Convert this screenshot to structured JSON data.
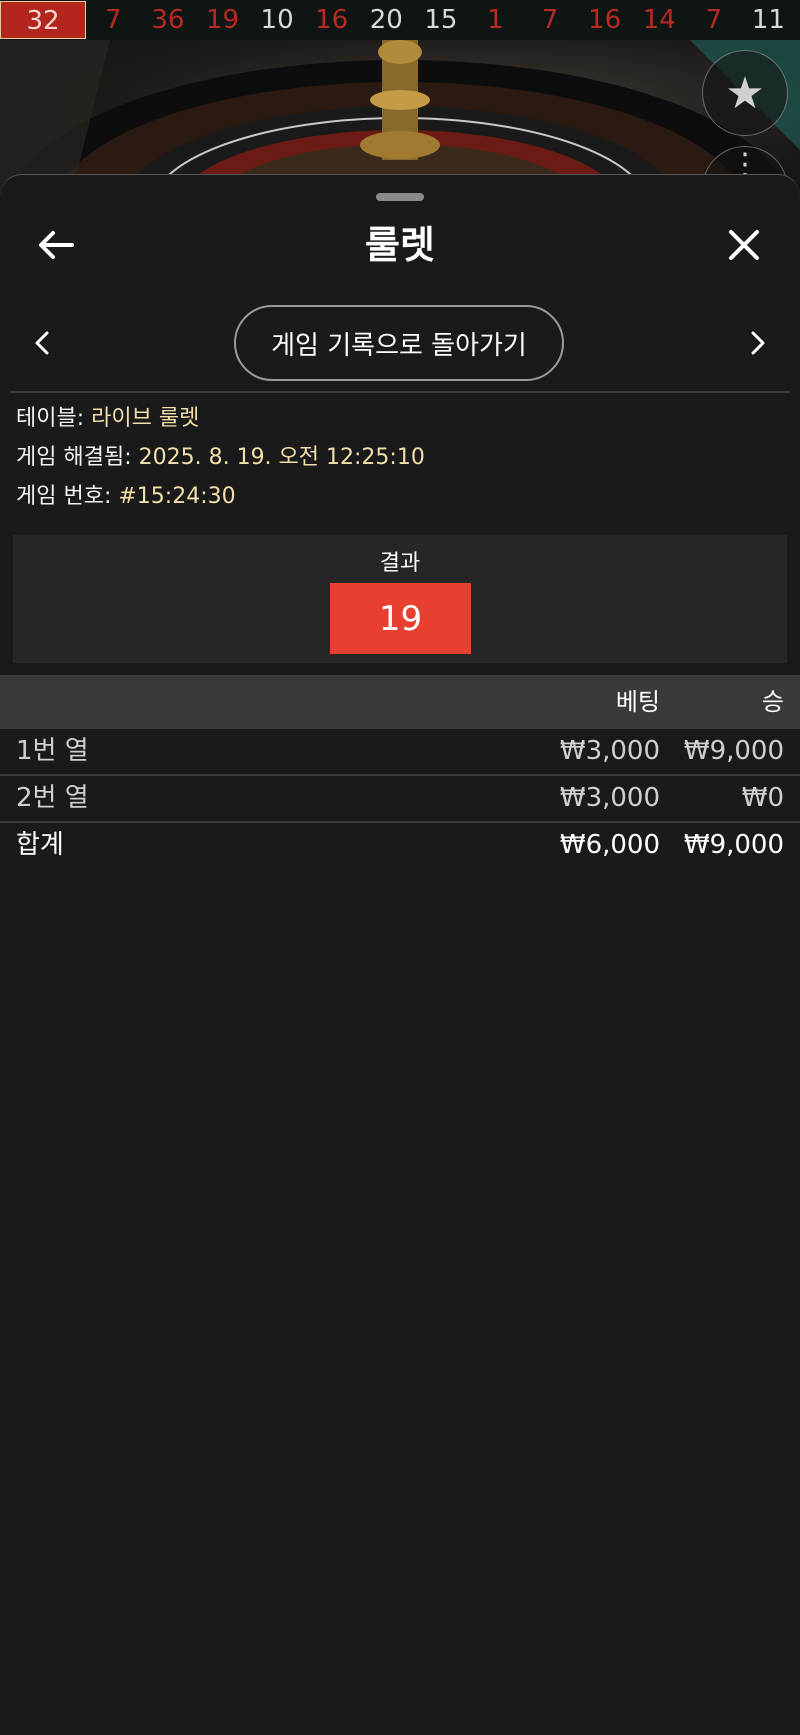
{
  "history": [
    {
      "n": "32",
      "c": "red"
    },
    {
      "n": "7",
      "c": "red"
    },
    {
      "n": "36",
      "c": "red"
    },
    {
      "n": "19",
      "c": "red"
    },
    {
      "n": "10",
      "c": "black"
    },
    {
      "n": "16",
      "c": "red"
    },
    {
      "n": "20",
      "c": "black"
    },
    {
      "n": "15",
      "c": "black"
    },
    {
      "n": "1",
      "c": "red"
    },
    {
      "n": "7",
      "c": "red"
    },
    {
      "n": "16",
      "c": "red"
    },
    {
      "n": "14",
      "c": "red"
    },
    {
      "n": "7",
      "c": "red"
    },
    {
      "n": "11",
      "c": "black"
    }
  ],
  "sheet": {
    "title": "룰렛",
    "back_icon": "arrow-left-icon",
    "close_icon": "close-icon",
    "history_button": "게임 기록으로 돌아가기"
  },
  "info": {
    "table_label": "테이블:",
    "table_value": "라이브 룰렛",
    "resolved_label": "게임 해결됨:",
    "resolved_value": "2025. 8. 19. 오전 12:25:10",
    "game_no_label": "게임 번호:",
    "game_no_value": "#15:24:30"
  },
  "result": {
    "label": "결과",
    "number": "19",
    "color": "#e84030"
  },
  "bets": {
    "header_bet": "베팅",
    "header_win": "승",
    "rows": [
      {
        "name": "1번 열",
        "bet": "₩3,000",
        "win": "₩9,000"
      },
      {
        "name": "2번 열",
        "bet": "₩3,000",
        "win": "₩0"
      }
    ],
    "total": {
      "name": "합계",
      "bet": "₩6,000",
      "win": "₩9,000"
    }
  }
}
